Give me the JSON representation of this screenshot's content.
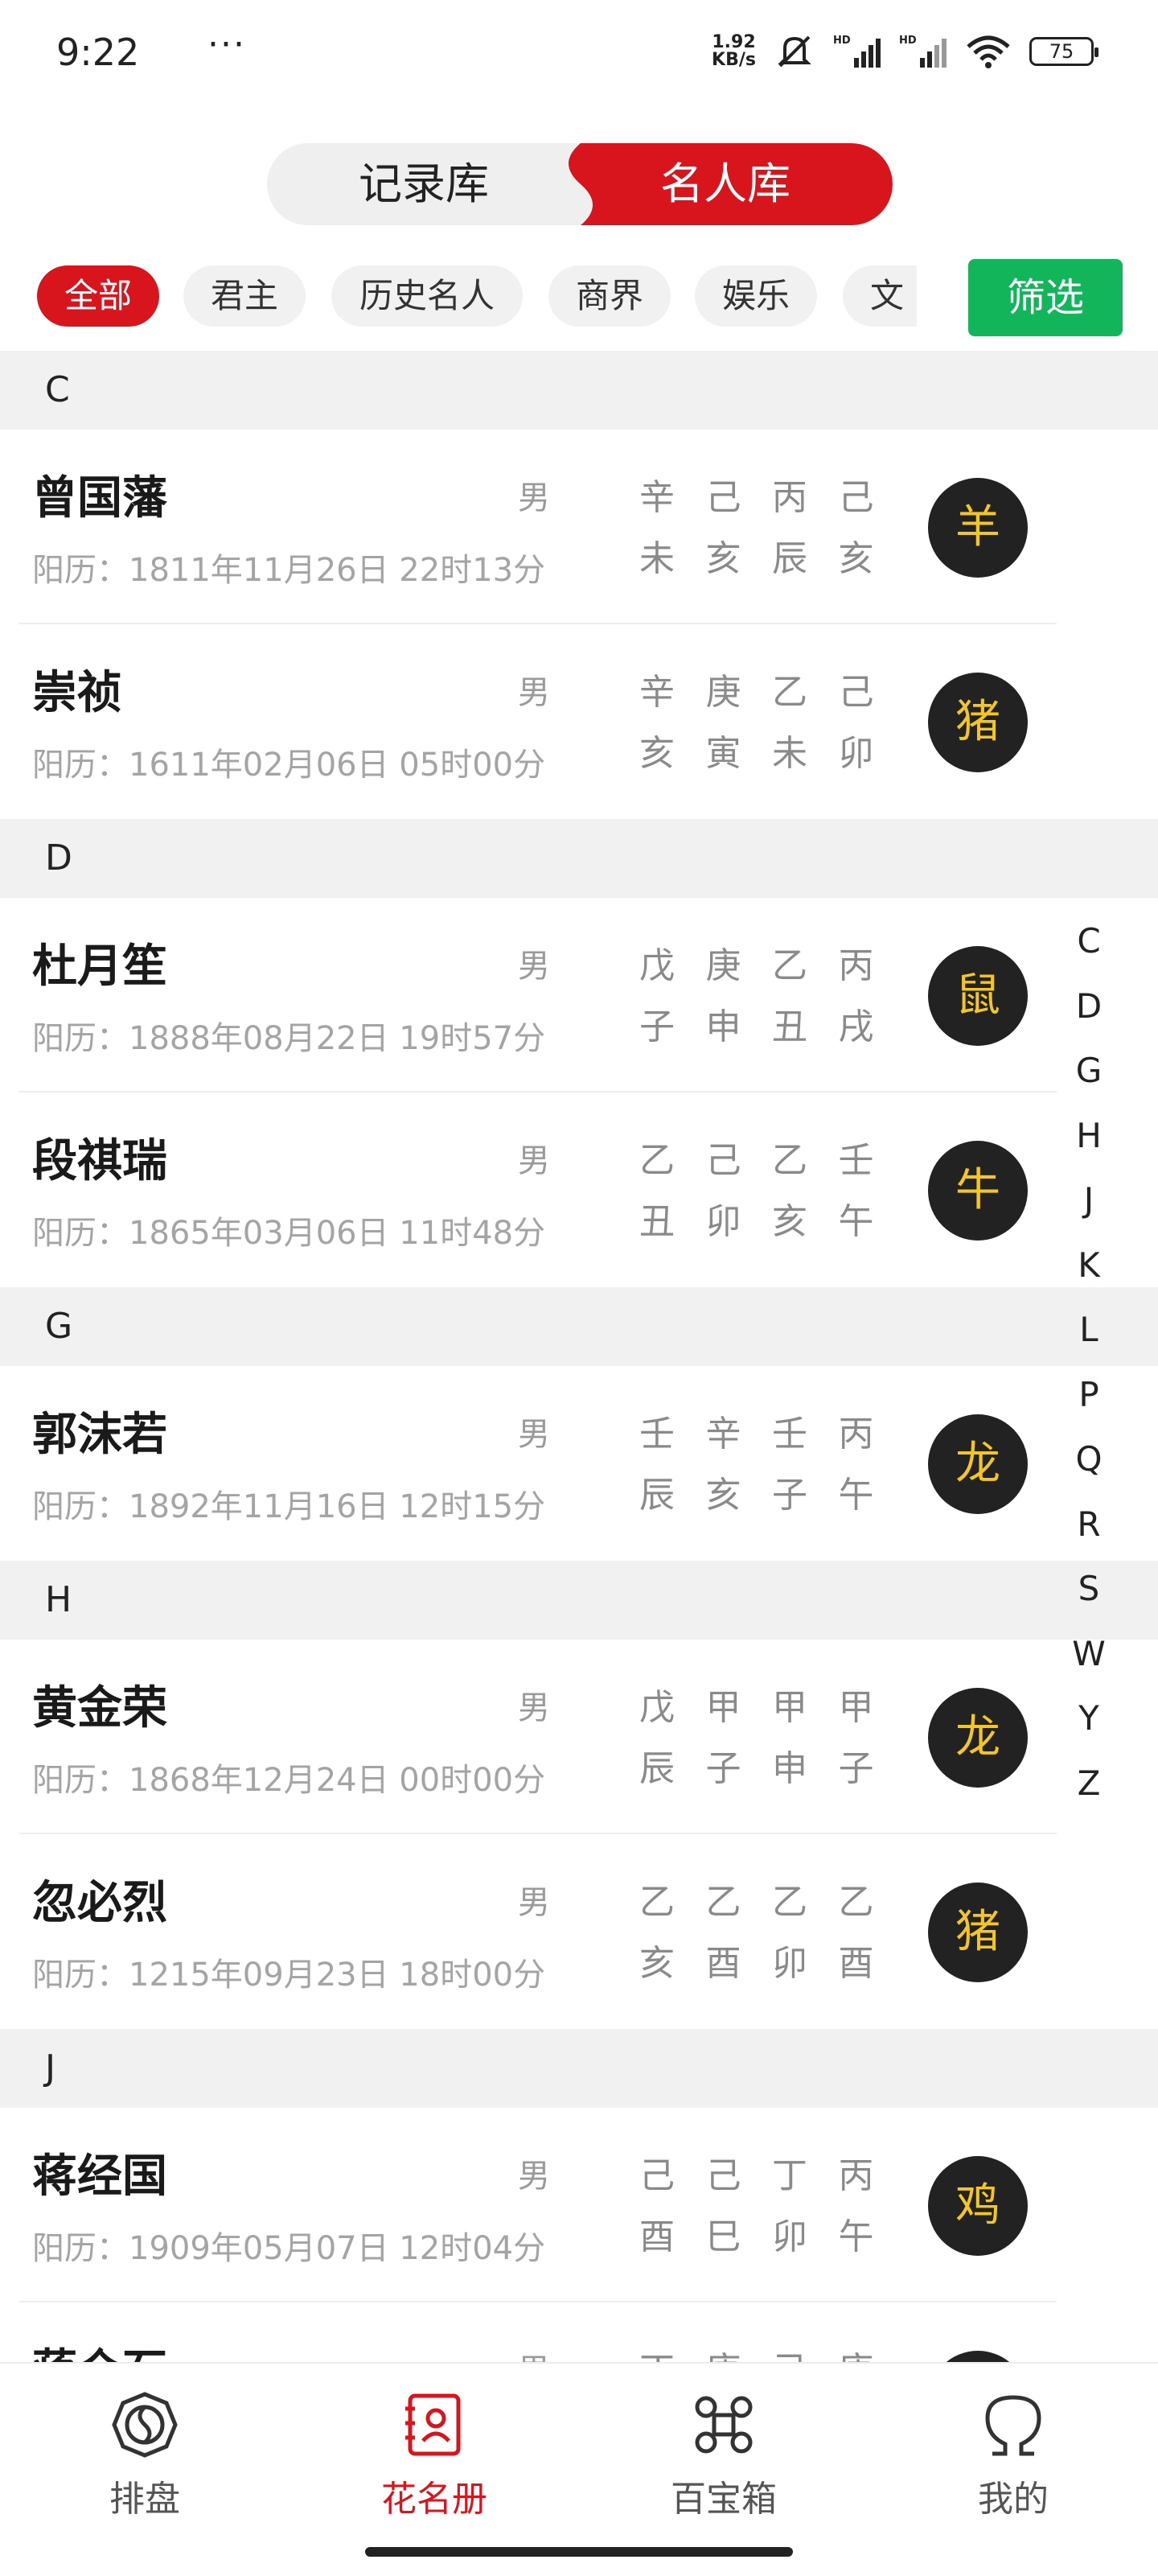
{
  "status_bar": {
    "time": "9:22",
    "dots": "···",
    "net_speed_value": "1.92",
    "net_speed_unit": "KB/s",
    "signal_label_1": "HD",
    "signal_label_2": "HD",
    "battery": "75",
    "icons": [
      "mute-icon",
      "signal-icon",
      "signal-icon",
      "wifi-icon",
      "battery-icon"
    ]
  },
  "tabs": {
    "record": "记录库",
    "celebrity": "名人库",
    "active": "名人库"
  },
  "chips": [
    {
      "label": "全部",
      "active": true
    },
    {
      "label": "君主",
      "active": false
    },
    {
      "label": "历史名人",
      "active": false
    },
    {
      "label": "商界",
      "active": false
    },
    {
      "label": "娱乐",
      "active": false
    },
    {
      "label": "文",
      "active": false
    }
  ],
  "filter_label": "筛选",
  "sections": [
    {
      "letter": "C",
      "people": [
        {
          "name": "曾国藩",
          "gender": "男",
          "date": "阳历：1811年11月26日 22时13分",
          "stems": [
            "辛",
            "己",
            "丙",
            "己"
          ],
          "branches": [
            "未",
            "亥",
            "辰",
            "亥"
          ],
          "zodiac": "羊"
        },
        {
          "name": "崇祯",
          "gender": "男",
          "date": "阳历：1611年02月06日 05时00分",
          "stems": [
            "辛",
            "庚",
            "乙",
            "己"
          ],
          "branches": [
            "亥",
            "寅",
            "未",
            "卯"
          ],
          "zodiac": "猪"
        }
      ]
    },
    {
      "letter": "D",
      "people": [
        {
          "name": "杜月笙",
          "gender": "男",
          "date": "阳历：1888年08月22日 19时57分",
          "stems": [
            "戊",
            "庚",
            "乙",
            "丙"
          ],
          "branches": [
            "子",
            "申",
            "丑",
            "戌"
          ],
          "zodiac": "鼠"
        },
        {
          "name": "段祺瑞",
          "gender": "男",
          "date": "阳历：1865年03月06日 11时48分",
          "stems": [
            "乙",
            "己",
            "乙",
            "壬"
          ],
          "branches": [
            "丑",
            "卯",
            "亥",
            "午"
          ],
          "zodiac": "牛"
        }
      ]
    },
    {
      "letter": "G",
      "people": [
        {
          "name": "郭沫若",
          "gender": "男",
          "date": "阳历：1892年11月16日 12时15分",
          "stems": [
            "壬",
            "辛",
            "壬",
            "丙"
          ],
          "branches": [
            "辰",
            "亥",
            "子",
            "午"
          ],
          "zodiac": "龙"
        }
      ]
    },
    {
      "letter": "H",
      "people": [
        {
          "name": "黄金荣",
          "gender": "男",
          "date": "阳历：1868年12月24日 00时00分",
          "stems": [
            "戊",
            "甲",
            "甲",
            "甲"
          ],
          "branches": [
            "辰",
            "子",
            "申",
            "子"
          ],
          "zodiac": "龙"
        },
        {
          "name": "忽必烈",
          "gender": "男",
          "date": "阳历：1215年09月23日 18时00分",
          "stems": [
            "乙",
            "乙",
            "乙",
            "乙"
          ],
          "branches": [
            "亥",
            "酉",
            "卯",
            "酉"
          ],
          "zodiac": "猪"
        }
      ]
    },
    {
      "letter": "J",
      "people": [
        {
          "name": "蒋经国",
          "gender": "男",
          "date": "阳历：1909年05月07日 12时04分",
          "stems": [
            "己",
            "己",
            "丁",
            "丙"
          ],
          "branches": [
            "酉",
            "巳",
            "卯",
            "午"
          ],
          "zodiac": "鸡"
        },
        {
          "name": "蒋介石",
          "gender": "男",
          "date": "",
          "stems": [
            "丁",
            "庚",
            "己",
            "庚"
          ],
          "branches": [
            "",
            "",
            "",
            ""
          ],
          "zodiac": ""
        }
      ]
    }
  ],
  "alpha_index": [
    "C",
    "D",
    "G",
    "H",
    "J",
    "K",
    "L",
    "P",
    "Q",
    "R",
    "S",
    "W",
    "Y",
    "Z"
  ],
  "bottom_nav": [
    {
      "label": "排盘",
      "icon": "bagua-icon",
      "active": false
    },
    {
      "label": "花名册",
      "icon": "roster-icon",
      "active": true
    },
    {
      "label": "百宝箱",
      "icon": "command-icon",
      "active": false
    },
    {
      "label": "我的",
      "icon": "profile-icon",
      "active": false
    }
  ],
  "colors": {
    "accent_red": "#d8141c",
    "filter_green": "#12b559",
    "zodiac_text": "#f3c623",
    "zodiac_bg": "#222222"
  }
}
